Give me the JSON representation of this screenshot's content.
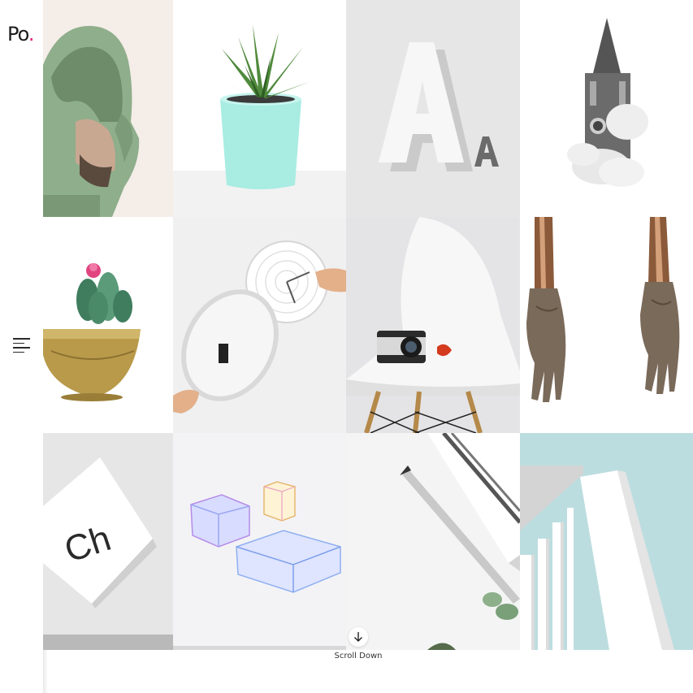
{
  "brand": {
    "logo_text": "Po",
    "logo_dot": ".",
    "dot_color": "#e8207c"
  },
  "navigation": {
    "menu_icon": "hamburger-menu-icon"
  },
  "gallery": {
    "items": [
      {
        "id": "hooded-man",
        "subject": "Man in green hoodie"
      },
      {
        "id": "succulent-pot",
        "subject": "Aloe in mint pot"
      },
      {
        "id": "letter-a",
        "subject": "White letter A sculpture"
      },
      {
        "id": "clock-tower",
        "subject": "Clock tower in clouds"
      },
      {
        "id": "cactus-brass",
        "subject": "Cactus in brass pot"
      },
      {
        "id": "wall-clock",
        "subject": "Hands holding wall clock"
      },
      {
        "id": "camera-chair",
        "subject": "Camera on white chair"
      },
      {
        "id": "bronze-hands",
        "subject": "Bronze hands"
      },
      {
        "id": "ch-poster",
        "subject": "Ch typography paper"
      },
      {
        "id": "glass-boxes",
        "subject": "Glass boxes"
      },
      {
        "id": "pencil-notebook",
        "subject": "Pencil and notebook"
      },
      {
        "id": "architecture",
        "subject": "White building facade"
      }
    ]
  },
  "scroll": {
    "label": "Scroll Down",
    "icon": "arrow-down-icon"
  }
}
